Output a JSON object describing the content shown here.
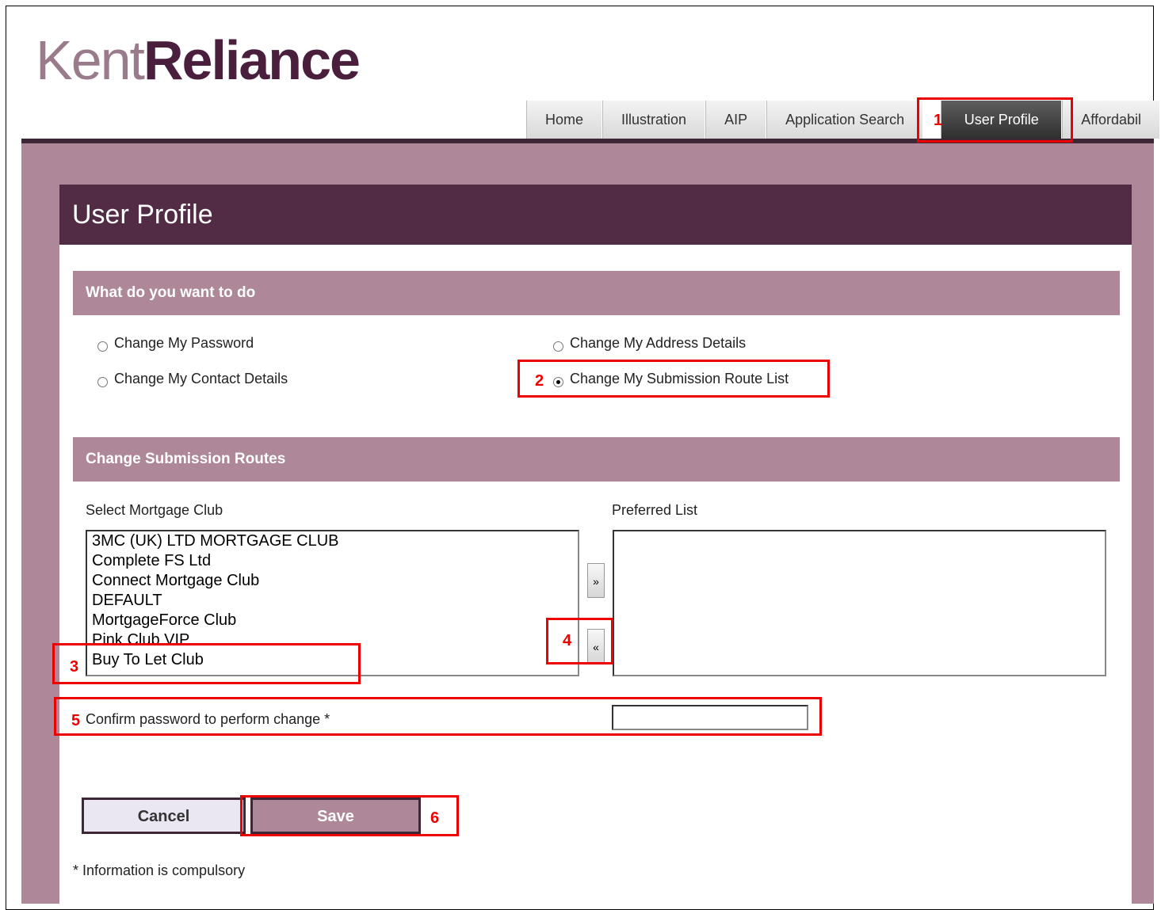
{
  "logo": {
    "part1": "Kent",
    "part2": "Reliance"
  },
  "nav": {
    "tabs": [
      {
        "label": "Home"
      },
      {
        "label": "Illustration"
      },
      {
        "label": "AIP"
      },
      {
        "label": "Application Search"
      },
      {
        "label": "User Profile",
        "active": true
      },
      {
        "label": "Affordabil"
      }
    ]
  },
  "page_title": "User Profile",
  "section1": {
    "title": "What do you want to do",
    "options": [
      {
        "label": "Change My Password",
        "selected": false
      },
      {
        "label": "Change My Address Details",
        "selected": false
      },
      {
        "label": "Change My Contact Details",
        "selected": false
      },
      {
        "label": "Change My Submission Route List",
        "selected": true
      }
    ]
  },
  "section2": {
    "title": "Change Submission Routes",
    "select_label": "Select Mortgage Club",
    "preferred_label": "Preferred List",
    "clubs": [
      "3MC (UK) LTD MORTGAGE CLUB",
      "Complete FS Ltd",
      "Connect Mortgage Club",
      "DEFAULT",
      "MortgageForce Club",
      "Pink Club VIP",
      "Buy To Let Club"
    ],
    "add_button": "»",
    "remove_button": "«",
    "confirm_label": "Confirm password to perform change *",
    "confirm_value": ""
  },
  "buttons": {
    "cancel": "Cancel",
    "save": "Save"
  },
  "footnote": "* Information is compulsory",
  "callout_numbers": [
    "1",
    "2",
    "3",
    "4",
    "5",
    "6"
  ],
  "colors": {
    "brand_dark": "#512c44",
    "brand_mid": "#ae8898",
    "callout": "#e00000"
  }
}
